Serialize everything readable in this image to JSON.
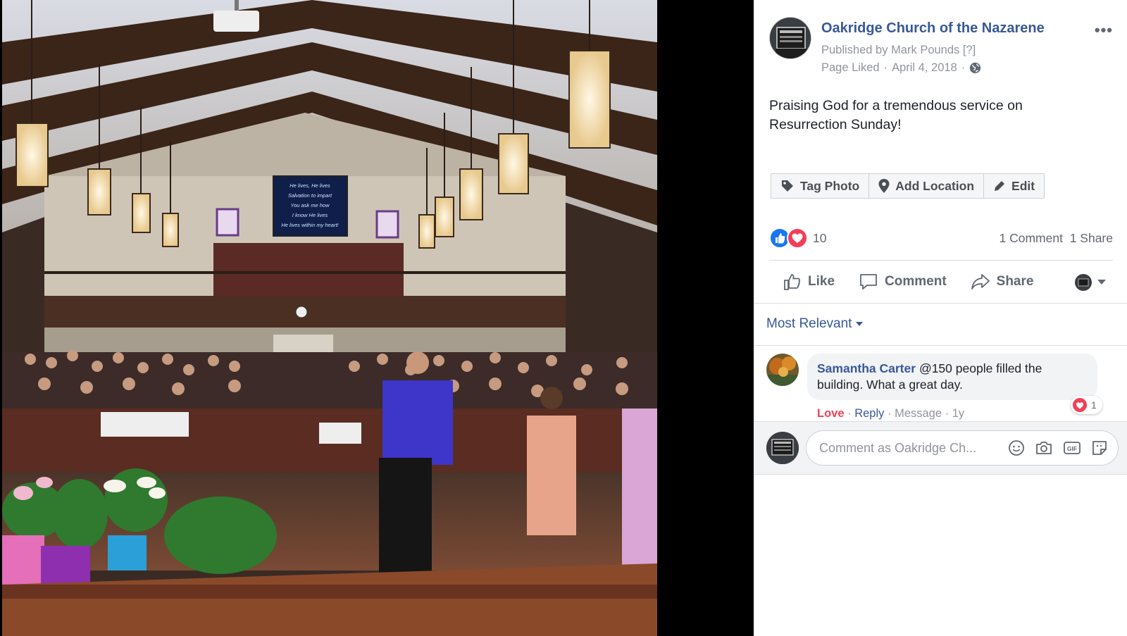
{
  "photo": {
    "screen_lines": [
      "He lives, He lives",
      "Salvation to impart",
      "You ask me how",
      "I know He lives",
      "He lives within my heart!"
    ]
  },
  "post": {
    "page_name": "Oakridge Church of the Nazarene",
    "published_by": "Published by Mark Pounds",
    "published_hint": "[?]",
    "page_liked": "Page Liked",
    "date": "April 4, 2018",
    "separator": "·",
    "text": "Praising God for a tremendous service on Resurrection Sunday!"
  },
  "photo_actions": {
    "tag_label": "Tag Photo",
    "location_label": "Add Location",
    "edit_label": "Edit"
  },
  "reactions": {
    "count": "10",
    "comments": "1 Comment",
    "shares": "1 Share"
  },
  "ufi": {
    "like_label": "Like",
    "comment_label": "Comment",
    "share_label": "Share"
  },
  "comments": {
    "sort_label": "Most Relevant",
    "items": [
      {
        "author": "Samantha Carter",
        "text": "@150 people filled the building. What a great day.",
        "reaction_count": "1",
        "love": "Love",
        "reply": "Reply",
        "message": "Message",
        "age": "1y"
      }
    ]
  },
  "composer": {
    "placeholder": "Comment as Oakridge Ch..."
  },
  "colors": {
    "link_blue": "#385898",
    "love_red": "#f33e58",
    "like_blue": "#1877f2",
    "muted": "#90949c"
  }
}
